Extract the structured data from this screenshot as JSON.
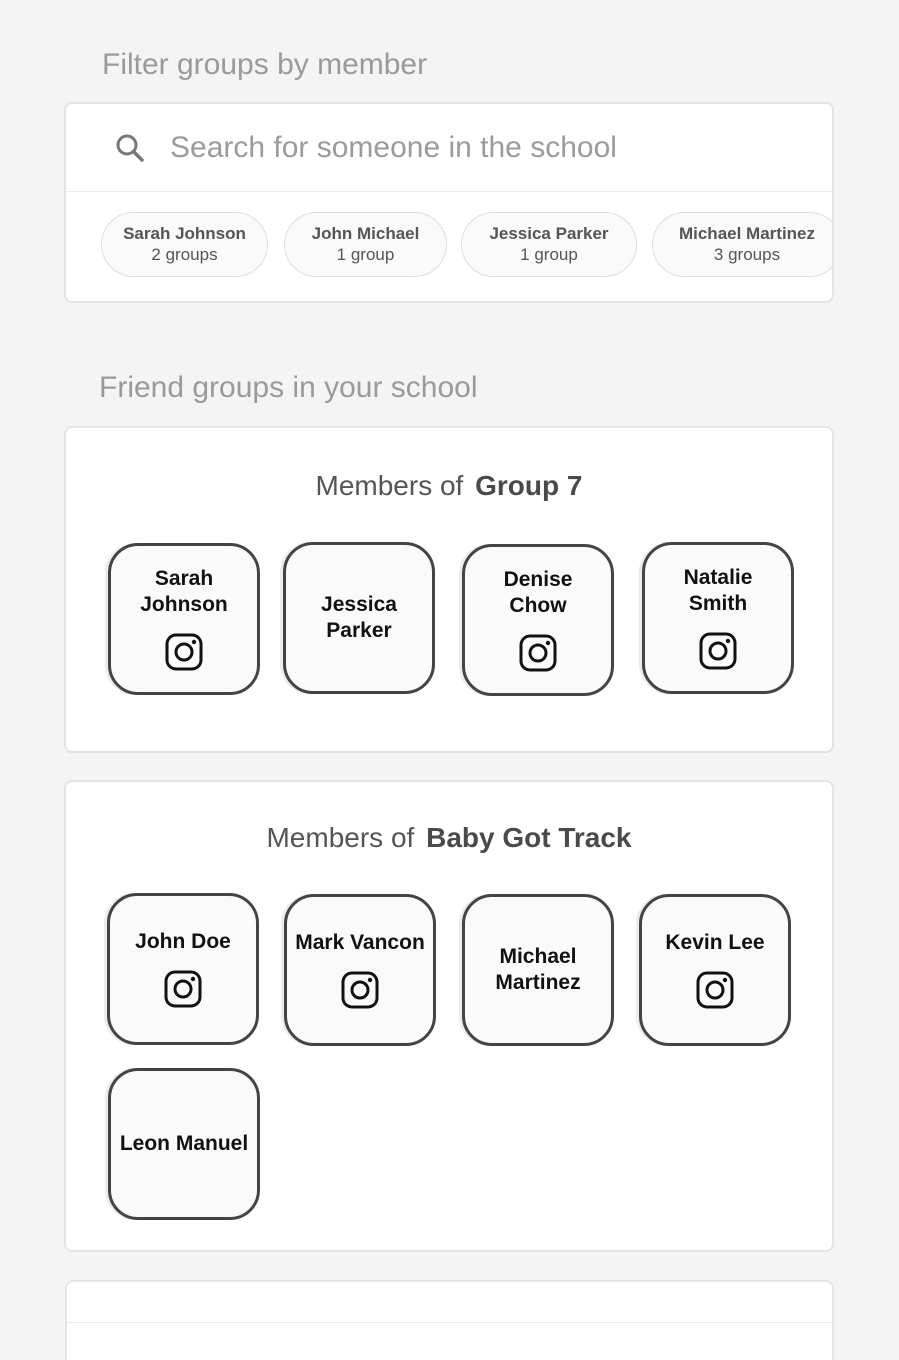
{
  "filter": {
    "heading": "Filter groups by member",
    "search_placeholder": "Search for someone in the school",
    "chips": [
      {
        "name": "Sarah Johnson",
        "count": "2 groups"
      },
      {
        "name": "John Michael",
        "count": "1 group"
      },
      {
        "name": "Jessica Parker",
        "count": "1 group"
      },
      {
        "name": "Michael Martinez",
        "count": "3 groups"
      }
    ]
  },
  "groups_section": {
    "heading": "Friend groups in your school",
    "groups": [
      {
        "prefix": "Members of",
        "name": "Group 7",
        "members": [
          {
            "name": "Sarah Johnson",
            "icon": "instagram-icon"
          },
          {
            "name": "Jessica Parker",
            "icon": ""
          },
          {
            "name": "Denise Chow",
            "icon": "instagram-icon"
          },
          {
            "name": "Natalie Smith",
            "icon": "instagram-icon"
          }
        ]
      },
      {
        "prefix": "Members of",
        "name": "Baby Got Track",
        "members": [
          {
            "name": "John Doe",
            "icon": "instagram-icon"
          },
          {
            "name": "Mark Vancon",
            "icon": "instagram-icon"
          },
          {
            "name": "Michael Martinez",
            "icon": ""
          },
          {
            "name": "Kevin Lee",
            "icon": "instagram-icon"
          },
          {
            "name": "Leon Manuel",
            "icon": ""
          }
        ]
      }
    ]
  },
  "colors": {
    "background": "#f4f4f4",
    "card": "#ffffff",
    "heading_text": "#9a9a9a",
    "tile_border": "#444444"
  }
}
